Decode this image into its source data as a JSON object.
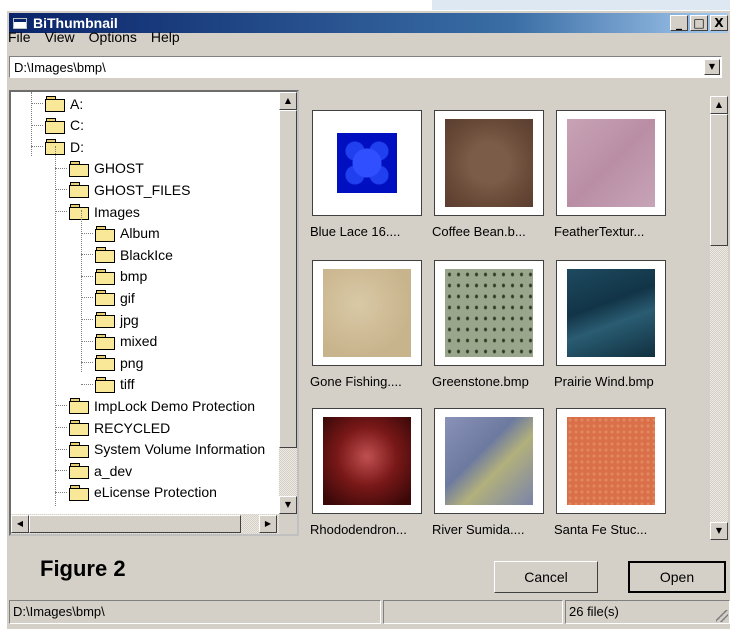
{
  "window": {
    "title": "BiThumbnail",
    "controls": [
      "_",
      "□",
      "X"
    ]
  },
  "menu": [
    "File",
    "View",
    "Options",
    "Help"
  ],
  "path": {
    "value": "D:\\Images\\bmp\\"
  },
  "tree": [
    {
      "label": "A:",
      "level": 1
    },
    {
      "label": "C:",
      "level": 1
    },
    {
      "label": "D:",
      "level": 1
    },
    {
      "label": "GHOST",
      "level": 2
    },
    {
      "label": "GHOST_FILES",
      "level": 2
    },
    {
      "label": "Images",
      "level": 2
    },
    {
      "label": "Album",
      "level": 3
    },
    {
      "label": "BlackIce",
      "level": 3
    },
    {
      "label": "bmp",
      "level": 3,
      "selected": true
    },
    {
      "label": "gif",
      "level": 3
    },
    {
      "label": "jpg",
      "level": 3
    },
    {
      "label": "mixed",
      "level": 3
    },
    {
      "label": "png",
      "level": 3
    },
    {
      "label": "tiff",
      "level": 3
    },
    {
      "label": "ImpLock Demo Protection",
      "level": 2
    },
    {
      "label": "RECYCLED",
      "level": 2
    },
    {
      "label": "System Volume Information",
      "level": 2
    },
    {
      "label": "a_dev",
      "level": 2
    },
    {
      "label": "eLicense Protection",
      "level": 2
    }
  ],
  "thumbnails": [
    {
      "label": "Blue Lace 16....",
      "style": "bluelace"
    },
    {
      "label": "Coffee Bean.b...",
      "style": "coffee"
    },
    {
      "label": "FeatherTextur...",
      "style": "feather"
    },
    {
      "label": "Gone Fishing....",
      "style": "fishing"
    },
    {
      "label": "Greenstone.bmp",
      "style": "greenstone"
    },
    {
      "label": "Prairie Wind.bmp",
      "style": "prairie"
    },
    {
      "label": "Rhododendron...",
      "style": "rhodo"
    },
    {
      "label": "River Sumida....",
      "style": "sumida"
    },
    {
      "label": "Santa Fe Stuc...",
      "style": "santafe"
    }
  ],
  "figure_label": "Figure 2",
  "buttons": {
    "cancel": "Cancel",
    "open": "Open"
  },
  "status": {
    "path": "D:\\Images\\bmp\\",
    "middle": "",
    "count": "26 file(s)"
  }
}
